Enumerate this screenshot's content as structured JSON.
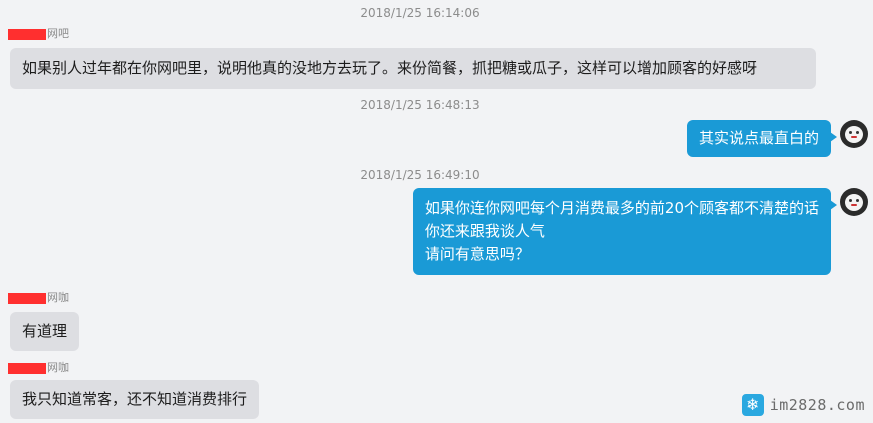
{
  "messages": [
    {
      "time": "2018/1/25 16:14:06",
      "sender": "网吧",
      "lines": [
        "如果别人过年都在你网吧里，说明他真的没地方去玩了。来份简餐，抓把糖或瓜子，这样可以增加顾客的好感呀"
      ]
    },
    {
      "time": "2018/1/25 16:48:13",
      "lines": [
        "其实说点最直白的"
      ]
    },
    {
      "time": "2018/1/25 16:49:10",
      "lines": [
        "如果你连你网吧每个月消费最多的前20个顾客都不清楚的话",
        "你还来跟我谈人气",
        "请问有意思吗？"
      ]
    },
    {
      "sender": "网咖",
      "lines": [
        "有道理"
      ]
    },
    {
      "sender": "网咖",
      "lines": [
        "我只知道常客，还不知道消费排行"
      ]
    }
  ],
  "watermark": {
    "text": "im2828.com",
    "icon": "snowflake-icon"
  },
  "colors": {
    "outgoing_bubble": "#1a9ad6",
    "incoming_bubble": "#dddee2",
    "background": "#f2f3f5",
    "redaction": "#ff2f2f"
  }
}
